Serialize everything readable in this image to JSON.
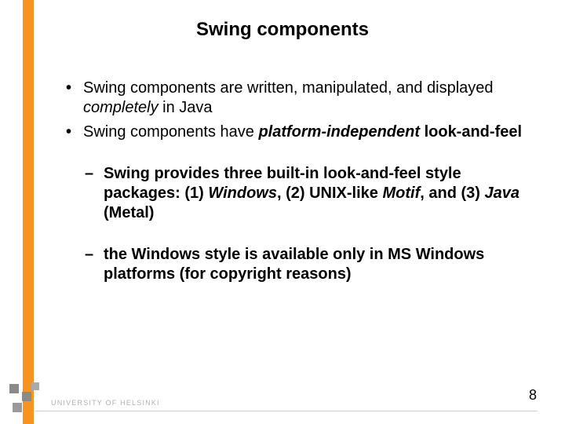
{
  "title": "Swing components",
  "bullets": {
    "b1": {
      "pre": "Swing components are written, manipulated, and displayed ",
      "em": "completely",
      "post": " in Java"
    },
    "b2": {
      "pre": "Swing components have ",
      "em": "platform-independent",
      "post": " look-and-feel"
    }
  },
  "sub": {
    "s1": {
      "t1": "Swing provides three built-in look-and-feel style packages: (1) ",
      "w": "Windows",
      "t2": ", (2) UNIX-like ",
      "m": "Motif",
      "t3": ", and (3) ",
      "j": "Java",
      "t4": " (Metal)"
    },
    "s2": "the Windows style is available only in MS Windows platforms (for copyright reasons)"
  },
  "footer": {
    "org": "UNIVERSITY OF HELSINKI",
    "page": "8"
  }
}
